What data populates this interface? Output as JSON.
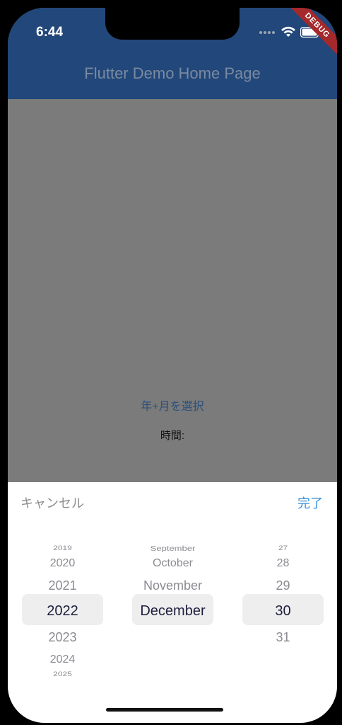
{
  "status_bar": {
    "time": "6:44"
  },
  "debug_banner": "DEBUG",
  "app_bar": {
    "title": "Flutter Demo Home Page"
  },
  "content": {
    "select_link": "年+月を選択",
    "time_label": "時間:"
  },
  "picker": {
    "cancel_label": "キャンセル",
    "done_label": "完了",
    "years": [
      "2019",
      "2020",
      "2021",
      "2022",
      "2023",
      "2024",
      "2025"
    ],
    "months": [
      "September",
      "October",
      "November",
      "December"
    ],
    "days": [
      "27",
      "28",
      "29",
      "30",
      "31"
    ],
    "selected": {
      "year": "2022",
      "month": "December",
      "day": "30"
    }
  },
  "colors": {
    "app_bar": "#22477a",
    "scrim": "#7b7b7b",
    "accent": "#3a8fd9",
    "debug": "#a5282b"
  }
}
